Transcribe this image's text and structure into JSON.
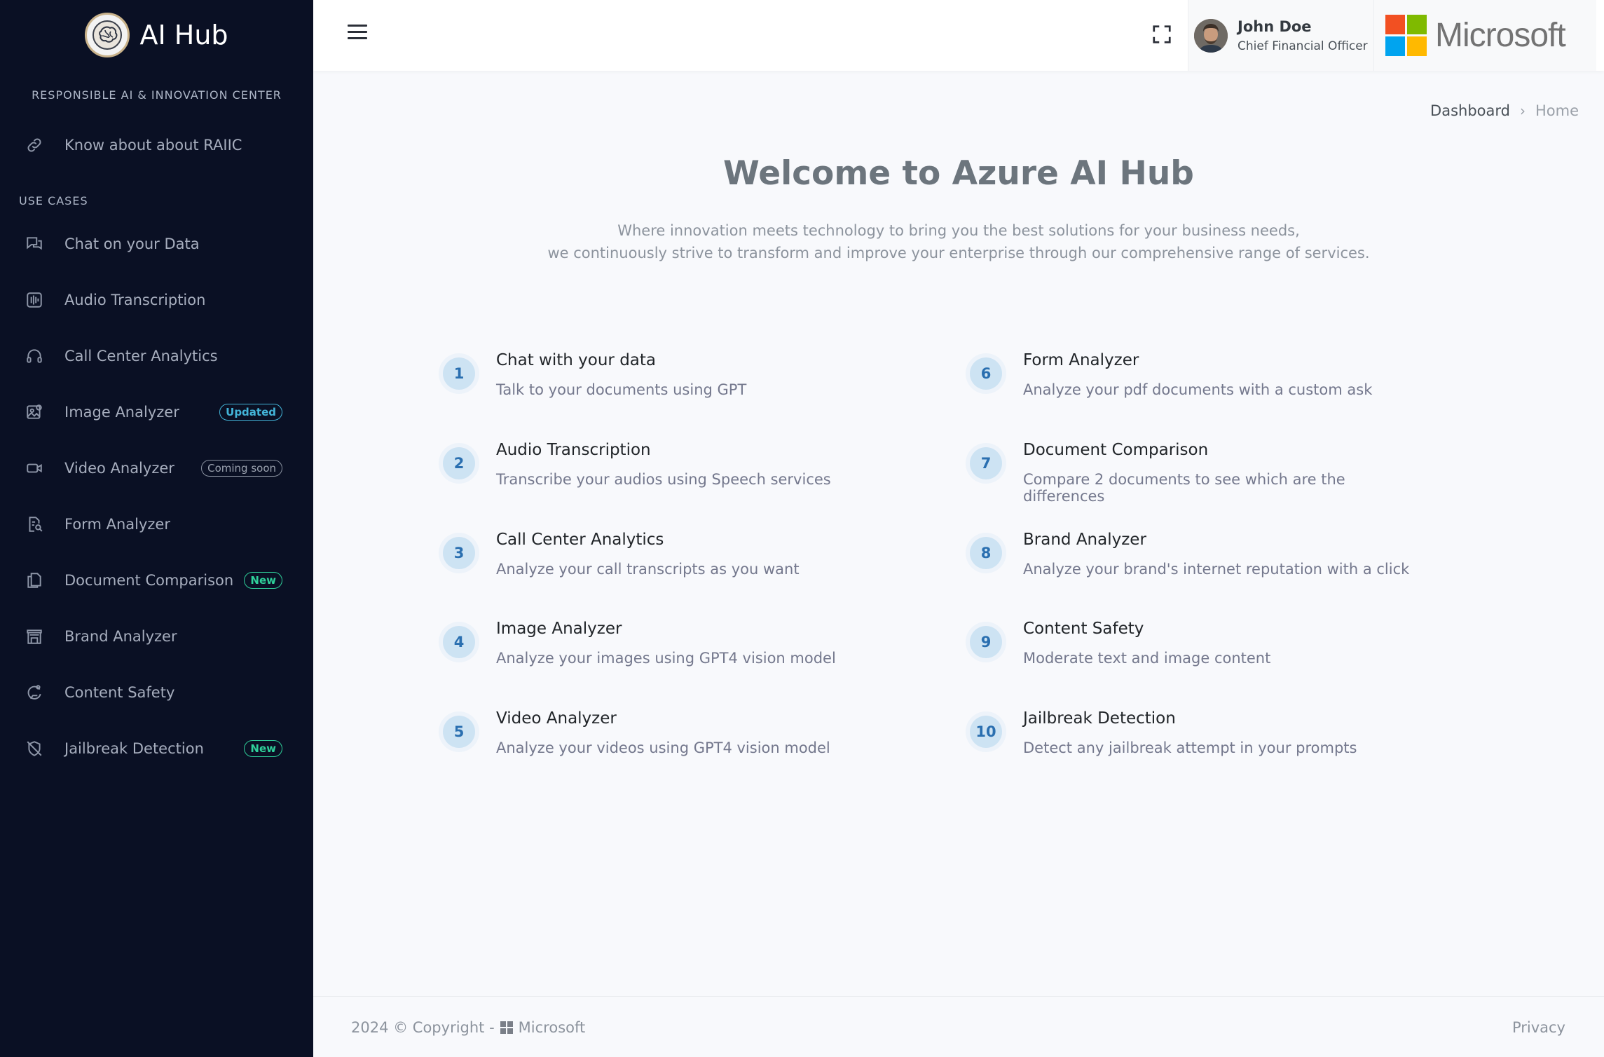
{
  "brand": {
    "name": "AI Hub",
    "subtitle": "RESPONSIBLE AI & INNOVATION CENTER"
  },
  "sidebar": {
    "about": {
      "label": "Know about about RAIIC",
      "icon": "link-icon"
    },
    "section_title": "USE CASES",
    "items": [
      {
        "label": "Chat on your Data",
        "icon": "chat-icon",
        "badge": null
      },
      {
        "label": "Audio Transcription",
        "icon": "audio-icon",
        "badge": null
      },
      {
        "label": "Call Center Analytics",
        "icon": "headset-icon",
        "badge": null
      },
      {
        "label": "Image Analyzer",
        "icon": "image-icon",
        "badge": "Updated"
      },
      {
        "label": "Video Analyzer",
        "icon": "video-icon",
        "badge": "Coming soon"
      },
      {
        "label": "Form Analyzer",
        "icon": "form-icon",
        "badge": null
      },
      {
        "label": "Document Comparison",
        "icon": "documents-icon",
        "badge": "New"
      },
      {
        "label": "Brand Analyzer",
        "icon": "store-icon",
        "badge": null
      },
      {
        "label": "Content Safety",
        "icon": "safety-icon",
        "badge": null
      },
      {
        "label": "Jailbreak Detection",
        "icon": "shield-off-icon",
        "badge": "New"
      }
    ]
  },
  "header": {
    "user": {
      "name": "John Doe",
      "role": "Chief Financial Officer"
    },
    "company": "Microsoft",
    "ms_colors": [
      "#f25022",
      "#7fba00",
      "#00a4ef",
      "#ffb900"
    ]
  },
  "breadcrumb": {
    "parent": "Dashboard",
    "current": "Home"
  },
  "main": {
    "title": "Welcome to Azure AI Hub",
    "subtitle_line1": "Where innovation meets technology to bring you the best solutions for your business needs,",
    "subtitle_line2": "we continuously strive to transform and improve your enterprise through our comprehensive range of services.",
    "use_cases": [
      {
        "num": "1",
        "title": "Chat with your data",
        "desc": "Talk to your documents using GPT"
      },
      {
        "num": "2",
        "title": "Audio Transcription",
        "desc": "Transcribe your audios using Speech services"
      },
      {
        "num": "3",
        "title": "Call Center Analytics",
        "desc": "Analyze your call transcripts as you want"
      },
      {
        "num": "4",
        "title": "Image Analyzer",
        "desc": "Analyze your images using GPT4 vision model"
      },
      {
        "num": "5",
        "title": "Video Analyzer",
        "desc": "Analyze your videos using GPT4 vision model"
      },
      {
        "num": "6",
        "title": "Form Analyzer",
        "desc": "Analyze your pdf documents with a custom ask"
      },
      {
        "num": "7",
        "title": "Document Comparison",
        "desc": "Compare 2 documents to see which are the differences"
      },
      {
        "num": "8",
        "title": "Brand Analyzer",
        "desc": "Analyze your brand's internet reputation with a click"
      },
      {
        "num": "9",
        "title": "Content Safety",
        "desc": "Moderate text and image content"
      },
      {
        "num": "10",
        "title": "Jailbreak Detection",
        "desc": "Detect any jailbreak attempt in your prompts"
      }
    ]
  },
  "footer": {
    "copyright": "2024 © Copyright -",
    "company": "Microsoft",
    "privacy": "Privacy"
  }
}
